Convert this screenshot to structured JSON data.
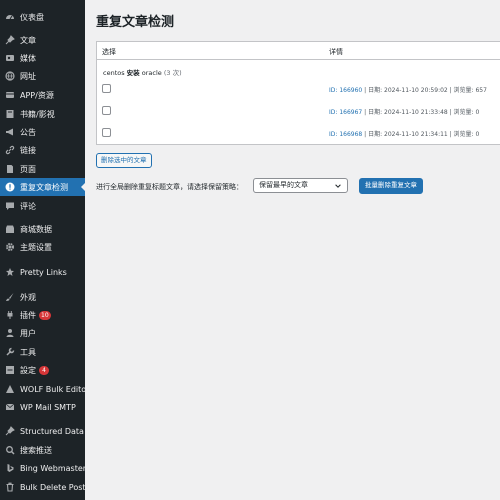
{
  "sidebar": {
    "items": [
      {
        "label": "仪表盘",
        "icon": "dashboard-icon"
      },
      {
        "label": "文章",
        "icon": "pin-icon"
      },
      {
        "label": "媒体",
        "icon": "media-icon"
      },
      {
        "label": "网址",
        "icon": "globe-icon"
      },
      {
        "label": "APP/资源",
        "icon": "card-icon"
      },
      {
        "label": "书籍/影视",
        "icon": "book-icon"
      },
      {
        "label": "公告",
        "icon": "megaphone-icon"
      },
      {
        "label": "链接",
        "icon": "link-icon"
      },
      {
        "label": "页面",
        "icon": "page-icon"
      },
      {
        "label": "重复文章检测",
        "icon": "warning-icon",
        "active": true
      },
      {
        "label": "评论",
        "icon": "comment-icon"
      },
      {
        "label": "商城数据",
        "icon": "store-icon"
      },
      {
        "label": "主题设置",
        "icon": "gear-icon"
      },
      {
        "label": "Pretty Links",
        "icon": "star-icon"
      },
      {
        "label": "外观",
        "icon": "brush-icon"
      },
      {
        "label": "插件",
        "icon": "plugin-icon",
        "badge": "10"
      },
      {
        "label": "用户",
        "icon": "user-icon"
      },
      {
        "label": "工具",
        "icon": "wrench-icon"
      },
      {
        "label": "設定",
        "icon": "settings-icon",
        "badge": "4"
      },
      {
        "label": "WOLF Bulk Editor",
        "icon": "wolf-icon"
      },
      {
        "label": "WP Mail SMTP",
        "icon": "mail-icon"
      },
      {
        "label": "Structured Data",
        "icon": "pin-icon"
      },
      {
        "label": "搜索推送",
        "icon": "search-push-icon"
      },
      {
        "label": "Bing Webmaster",
        "icon": "bing-icon"
      },
      {
        "label": "Bulk Delete Posts",
        "icon": "bulk-delete-icon"
      }
    ]
  },
  "main": {
    "title": "重复文章检测",
    "table": {
      "col_select": "选择",
      "col_detail": "详情",
      "group": {
        "name_prefix": "centos ",
        "name_strong": "安装",
        "name_suffix": " oracle ",
        "count": "(3 次)"
      },
      "rows": [
        {
          "id": "ID: 166960",
          "rest": " | 日期: 2024-11-10 20:59:02 | 浏览量: 657"
        },
        {
          "id": "ID: 166967",
          "rest": " | 日期: 2024-11-10 21:33:48 | 浏览量: 0"
        },
        {
          "id": "ID: 166968",
          "rest": " | 日期: 2024-11-10 21:34:11 | 浏览量: 0"
        }
      ]
    },
    "delete_selected_label": "删除选中的文章",
    "bulk_label": "进行全局删除重复标题文章，请选择保留策略：",
    "select_value": "保留最早的文章",
    "bulk_button_label": "批量删除重复文章"
  },
  "colors": {
    "sidebar_bg": "#1d2327",
    "accent": "#2271b1",
    "badge": "#d63638",
    "page_bg": "#f0f0f1"
  }
}
